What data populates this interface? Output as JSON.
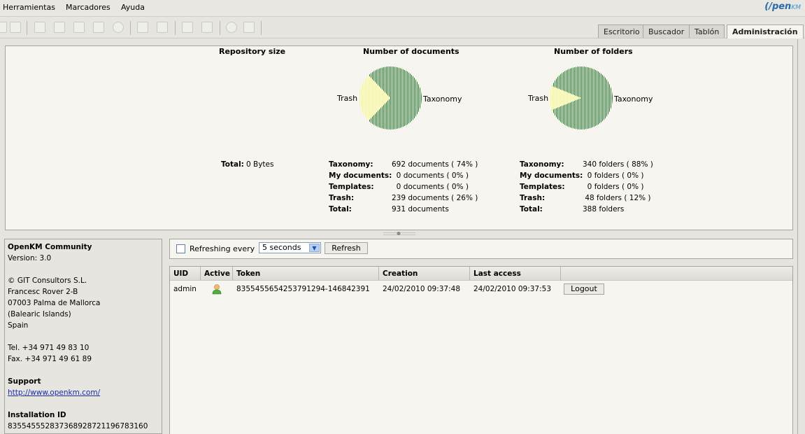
{
  "menu": {
    "items": [
      "Herramientas",
      "Marcadores",
      "Ayuda"
    ],
    "logo": {
      "main": "openKM",
      "prefix": "(/pen",
      "suffix": "KM"
    }
  },
  "toolbar": {
    "icons": [
      "lock-icon",
      "unlock-icon",
      "add-document-icon",
      "edit-document-icon",
      "checkout-icon",
      "checkin-icon",
      "cancel-checkout-icon",
      "add-property-group-icon",
      "remove-property-group-icon",
      "add-subscription-icon",
      "remove-subscription-icon",
      "refresh-icon",
      "home-icon"
    ]
  },
  "tabs": [
    {
      "label": "Escritorio",
      "active": false
    },
    {
      "label": "Buscador",
      "active": false
    },
    {
      "label": "Tablón",
      "active": false
    },
    {
      "label": "Administración",
      "active": true
    }
  ],
  "stats": {
    "repository": {
      "title": "Repository size",
      "total_label": "Total:",
      "total_value": "0 Bytes"
    },
    "documents": {
      "title": "Number of documents",
      "rows": [
        {
          "key": "Taxonomy:",
          "value": "692 documents ( 74% )"
        },
        {
          "key": "My documents:",
          "value": "  0 documents ( 0% )"
        },
        {
          "key": "Templates:",
          "value": "  0 documents ( 0% )"
        },
        {
          "key": "Trash:",
          "value": "239 documents ( 26% )"
        },
        {
          "key": "Total:",
          "value": "931 documents"
        }
      ]
    },
    "folders": {
      "title": "Number of folders",
      "rows": [
        {
          "key": "Taxonomy:",
          "value": "340 folders ( 88% )"
        },
        {
          "key": "My documents:",
          "value": "  0 folders ( 0% )"
        },
        {
          "key": "Templates:",
          "value": "  0 folders ( 0% )"
        },
        {
          "key": "Trash:",
          "value": " 48 folders ( 12% )"
        },
        {
          "key": "Total:",
          "value": "388 folders"
        }
      ]
    }
  },
  "chart_data": [
    {
      "type": "pie",
      "title": "Number of documents",
      "categories": [
        "Taxonomy",
        "My documents",
        "Templates",
        "Trash"
      ],
      "values": [
        692,
        0,
        0,
        239
      ],
      "labels_shown": [
        "Trash",
        "Taxonomy"
      ],
      "colors": {
        "Taxonomy": "#1f7a1f",
        "Trash": "#f7f77a"
      }
    },
    {
      "type": "pie",
      "title": "Number of folders",
      "categories": [
        "Taxonomy",
        "My documents",
        "Templates",
        "Trash"
      ],
      "values": [
        340,
        0,
        0,
        48
      ],
      "labels_shown": [
        "Trash",
        "Taxonomy"
      ],
      "colors": {
        "Taxonomy": "#1f7a1f",
        "Trash": "#f7f77a"
      }
    }
  ],
  "info": {
    "product": "OpenKM Community",
    "version": "Version: 3.0",
    "copyright": "© GIT Consultors S.L.",
    "address1": "Francesc Rover 2-B",
    "address2": "07003 Palma de Mallorca",
    "address3": "(Balearic Islands)",
    "country": "Spain",
    "tel": "Tel. +34 971 49 83 10",
    "fax": "Fax. +34 971 49 61 89",
    "support_label": "Support",
    "support_link": "http://www.openkm.com/",
    "installation_label": "Installation ID",
    "installation_id": "835545552837368928721196783160"
  },
  "refresh": {
    "checked": false,
    "label": "Refreshing every",
    "interval": "5 seconds",
    "button": "Refresh"
  },
  "sessions": {
    "columns": [
      "UID",
      "Active",
      "Token",
      "Creation",
      "Last access"
    ],
    "rows": [
      {
        "uid": "admin",
        "active_icon": "user-icon",
        "token": "835545565425379129​4-146842391",
        "creation": "24/02/2010 09:37:48",
        "last_access": "24/02/2010 09:37:53",
        "action": "Logout"
      }
    ]
  }
}
